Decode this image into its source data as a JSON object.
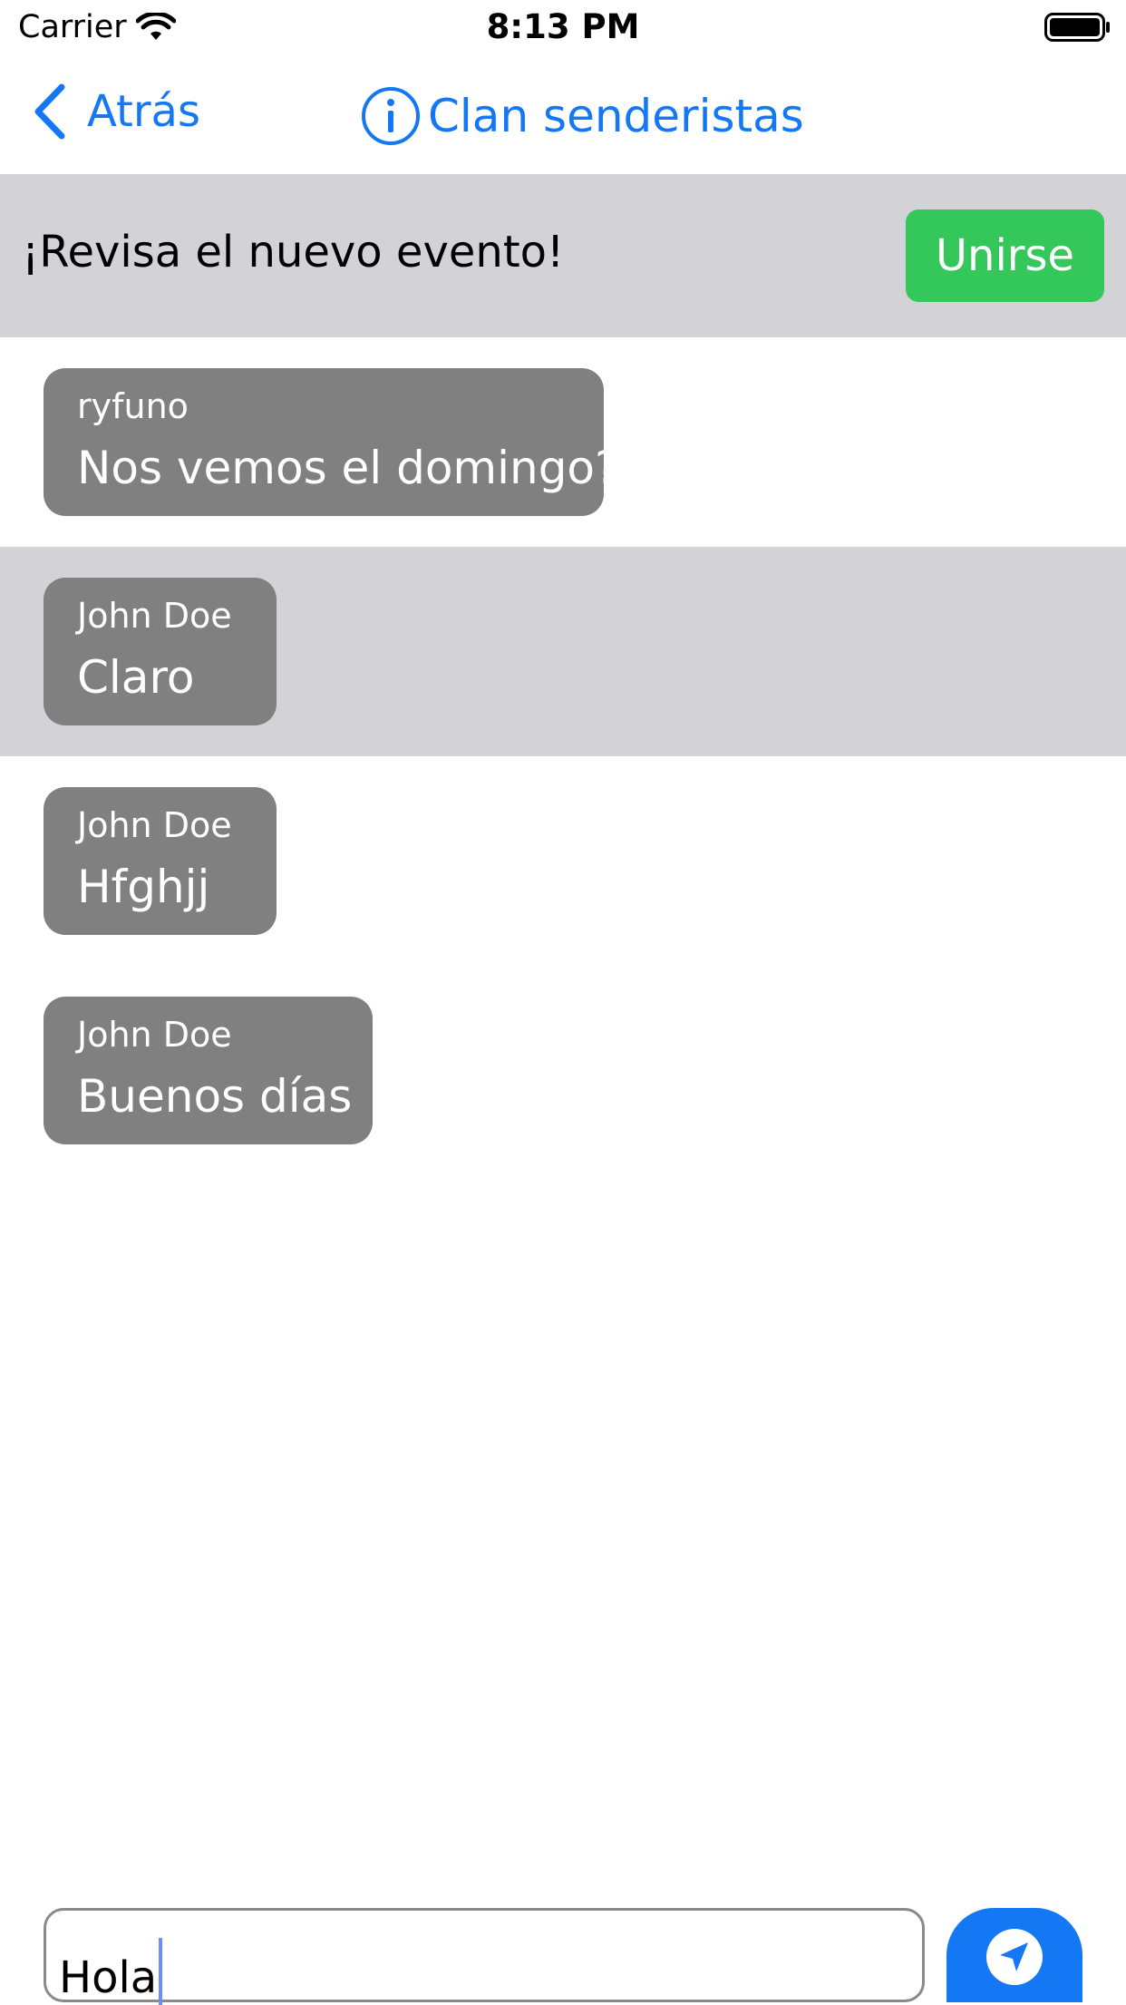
{
  "status_bar": {
    "carrier": "Carrier",
    "time": "8:13 PM"
  },
  "nav": {
    "back_label": "Atrás",
    "title": "Clan senderistas"
  },
  "banner": {
    "text": "¡Revisa el nuevo evento!",
    "button_label": "Unirse"
  },
  "messages": [
    {
      "sender": "ryfuno",
      "text": "Nos vemos el domingo?"
    },
    {
      "sender": "John Doe",
      "text": "Claro"
    },
    {
      "sender": "John Doe",
      "text": "Hfghjj"
    },
    {
      "sender": "John Doe",
      "text": "Buenos días"
    }
  ],
  "composer": {
    "value": "Hola"
  },
  "colors": {
    "accent": "#1478f5",
    "join": "#34c759",
    "bubble": "#808080",
    "highlight": "#d2d2d7"
  },
  "icons": [
    "wifi-icon",
    "battery-icon",
    "chevron-left-icon",
    "info-circle-icon",
    "send-arrow-icon"
  ]
}
